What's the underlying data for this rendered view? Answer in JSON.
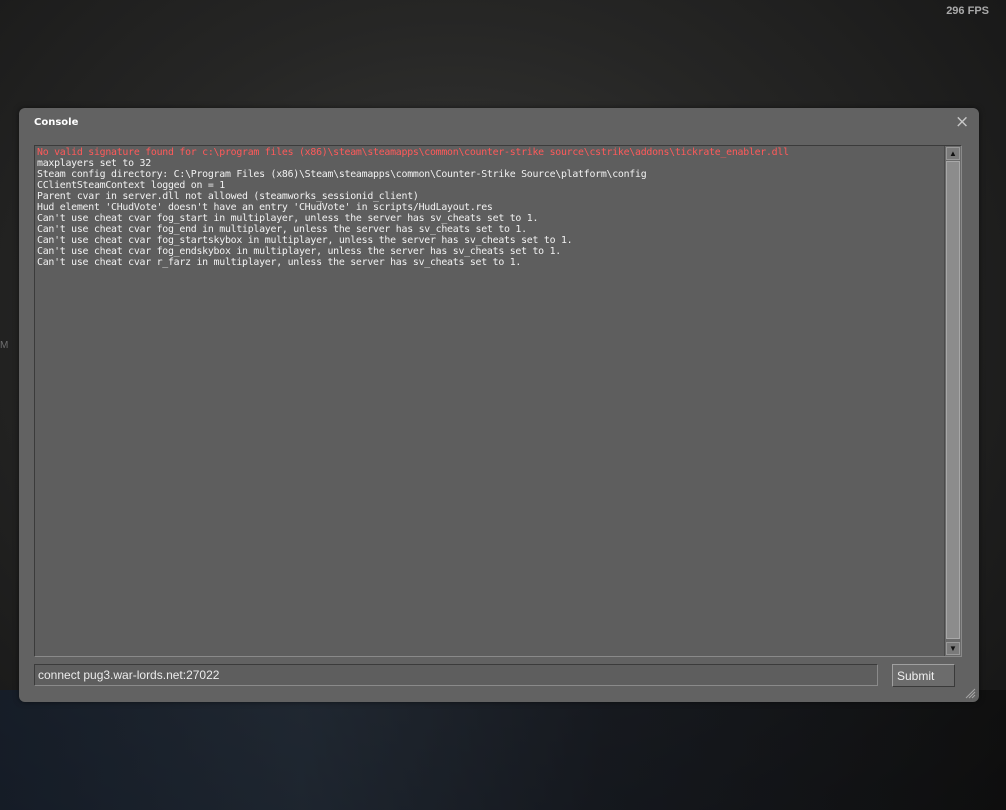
{
  "hud": {
    "fps": "296 FPS"
  },
  "background": {
    "glyph": "M"
  },
  "console": {
    "title": "Console",
    "close_label": "×",
    "log": [
      {
        "text": "No valid signature found for c:\\program files (x86)\\steam\\steamapps\\common\\counter-strike source\\cstrike\\addons\\tickrate_enabler.dll",
        "type": "error"
      },
      {
        "text": "maxplayers set to 32",
        "type": "normal"
      },
      {
        "text": "Steam config directory: C:\\Program Files (x86)\\Steam\\steamapps\\common\\Counter-Strike Source\\platform\\config",
        "type": "normal"
      },
      {
        "text": "CClientSteamContext logged on = 1",
        "type": "normal"
      },
      {
        "text": "Parent cvar in server.dll not allowed (steamworks_sessionid_client)",
        "type": "normal"
      },
      {
        "text": "Hud element 'CHudVote' doesn't have an entry 'CHudVote' in scripts/HudLayout.res",
        "type": "normal"
      },
      {
        "text": "Can't use cheat cvar fog_start in multiplayer, unless the server has sv_cheats set to 1.",
        "type": "normal"
      },
      {
        "text": "Can't use cheat cvar fog_end in multiplayer, unless the server has sv_cheats set to 1.",
        "type": "normal"
      },
      {
        "text": "Can't use cheat cvar fog_startskybox in multiplayer, unless the server has sv_cheats set to 1.",
        "type": "normal"
      },
      {
        "text": "Can't use cheat cvar fog_endskybox in multiplayer, unless the server has sv_cheats set to 1.",
        "type": "normal"
      },
      {
        "text": "Can't use cheat cvar r_farz in multiplayer, unless the server has sv_cheats set to 1.",
        "type": "normal"
      }
    ],
    "input_value": "connect pug3.war-lords.net:27022",
    "submit_label": "Submit",
    "scroll_up_glyph": "▲",
    "scroll_down_glyph": "▼"
  },
  "colors": {
    "error_text": "#ff5a5a",
    "normal_text": "#f2f2f2",
    "panel_bg": "#626262"
  }
}
